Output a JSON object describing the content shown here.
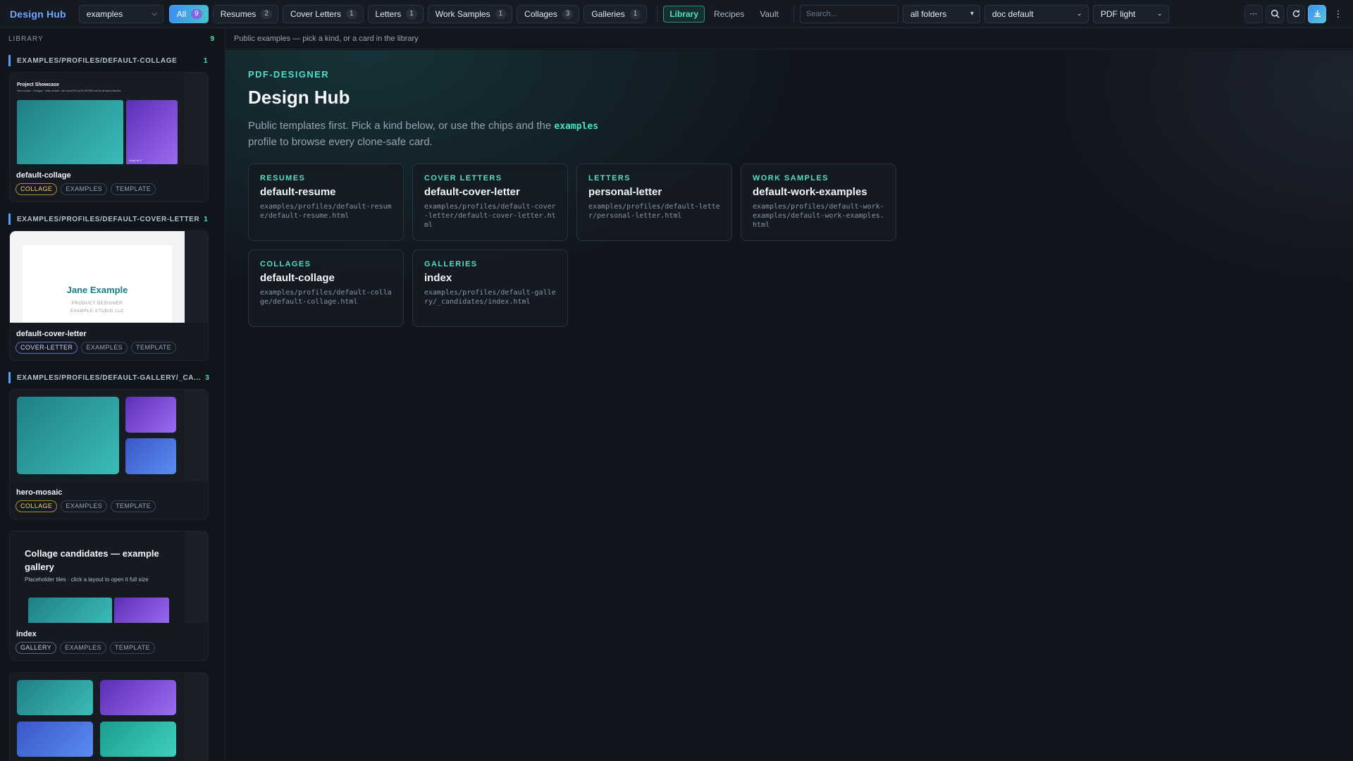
{
  "topbar": {
    "brand": "Design Hub",
    "profile_select": "examples",
    "chips": [
      {
        "label": "All",
        "count": "9"
      },
      {
        "label": "Resumes",
        "count": "2"
      },
      {
        "label": "Cover Letters",
        "count": "1"
      },
      {
        "label": "Letters",
        "count": "1"
      },
      {
        "label": "Work Samples",
        "count": "1"
      },
      {
        "label": "Collages",
        "count": "3"
      },
      {
        "label": "Galleries",
        "count": "1"
      }
    ],
    "nav": {
      "library": "Library",
      "recipes": "Recipes",
      "vault": "Vault"
    },
    "search_placeholder": "Search...",
    "folders_select": "all folders",
    "doc_select": "doc default",
    "theme_select": "PDF light",
    "colors": {
      "accent": "#4fe0c2",
      "brand": "#6fa6ff"
    }
  },
  "sidebar": {
    "title": "LIBRARY",
    "count": "9",
    "groups": [
      {
        "path": "EXAMPLES/PROFILES/DEFAULT-COLLAGE",
        "count": "1",
        "cards": [
          {
            "title": "default-collage",
            "tags": [
              "COLLAGE",
              "EXAMPLES",
              "TEMPLATE"
            ],
            "thumb": {
              "heading": "Project Showcase",
              "subheading": "Hero mosaic · 3 images · letter portrait · see docs/COLLAGE-DESIGN.md for all layout families",
              "caption": "Image tile 2"
            }
          }
        ]
      },
      {
        "path": "EXAMPLES/PROFILES/DEFAULT-COVER-LETTER",
        "count": "1",
        "cards": [
          {
            "title": "default-cover-letter",
            "tags": [
              "COVER-LETTER",
              "EXAMPLES",
              "TEMPLATE"
            ],
            "thumb": {
              "name": "Jane Example",
              "role": "PRODUCT DESIGNER",
              "company": "EXAMPLE STUDIO LLC"
            }
          }
        ]
      },
      {
        "path": "EXAMPLES/PROFILES/DEFAULT-GALLERY/_CA...",
        "count": "3",
        "cards": [
          {
            "title": "hero-mosaic",
            "tags": [
              "COLLAGE",
              "EXAMPLES",
              "TEMPLATE"
            ]
          },
          {
            "title": "index",
            "tags": [
              "GALLERY",
              "EXAMPLES",
              "TEMPLATE"
            ],
            "thumb": {
              "heading": "Collage candidates — example gallery",
              "subheading": "Placeholder tiles · click a layout to open it full size"
            }
          }
        ]
      }
    ]
  },
  "breadcrumb": "Public examples — pick a kind, or a card in the library",
  "main": {
    "eyebrow": "PDF-DESIGNER",
    "title": "Design Hub",
    "intro_before": "Public templates first. Pick a kind below, or use the chips and the ",
    "intro_code": "examples",
    "intro_after": " profile to browse every clone-safe card.",
    "kinds": [
      {
        "label": "RESUMES",
        "name": "default-resume",
        "path": "examples/profiles/default-resume/default-resume.html"
      },
      {
        "label": "COVER LETTERS",
        "name": "default-cover-letter",
        "path": "examples/profiles/default-cover-letter/default-cover-letter.html"
      },
      {
        "label": "LETTERS",
        "name": "personal-letter",
        "path": "examples/profiles/default-letter/personal-letter.html"
      },
      {
        "label": "WORK SAMPLES",
        "name": "default-work-examples",
        "path": "examples/profiles/default-work-examples/default-work-examples.html"
      },
      {
        "label": "COLLAGES",
        "name": "default-collage",
        "path": "examples/profiles/default-collage/default-collage.html"
      },
      {
        "label": "GALLERIES",
        "name": "index",
        "path": "examples/profiles/default-gallery/_candidates/index.html"
      }
    ]
  }
}
